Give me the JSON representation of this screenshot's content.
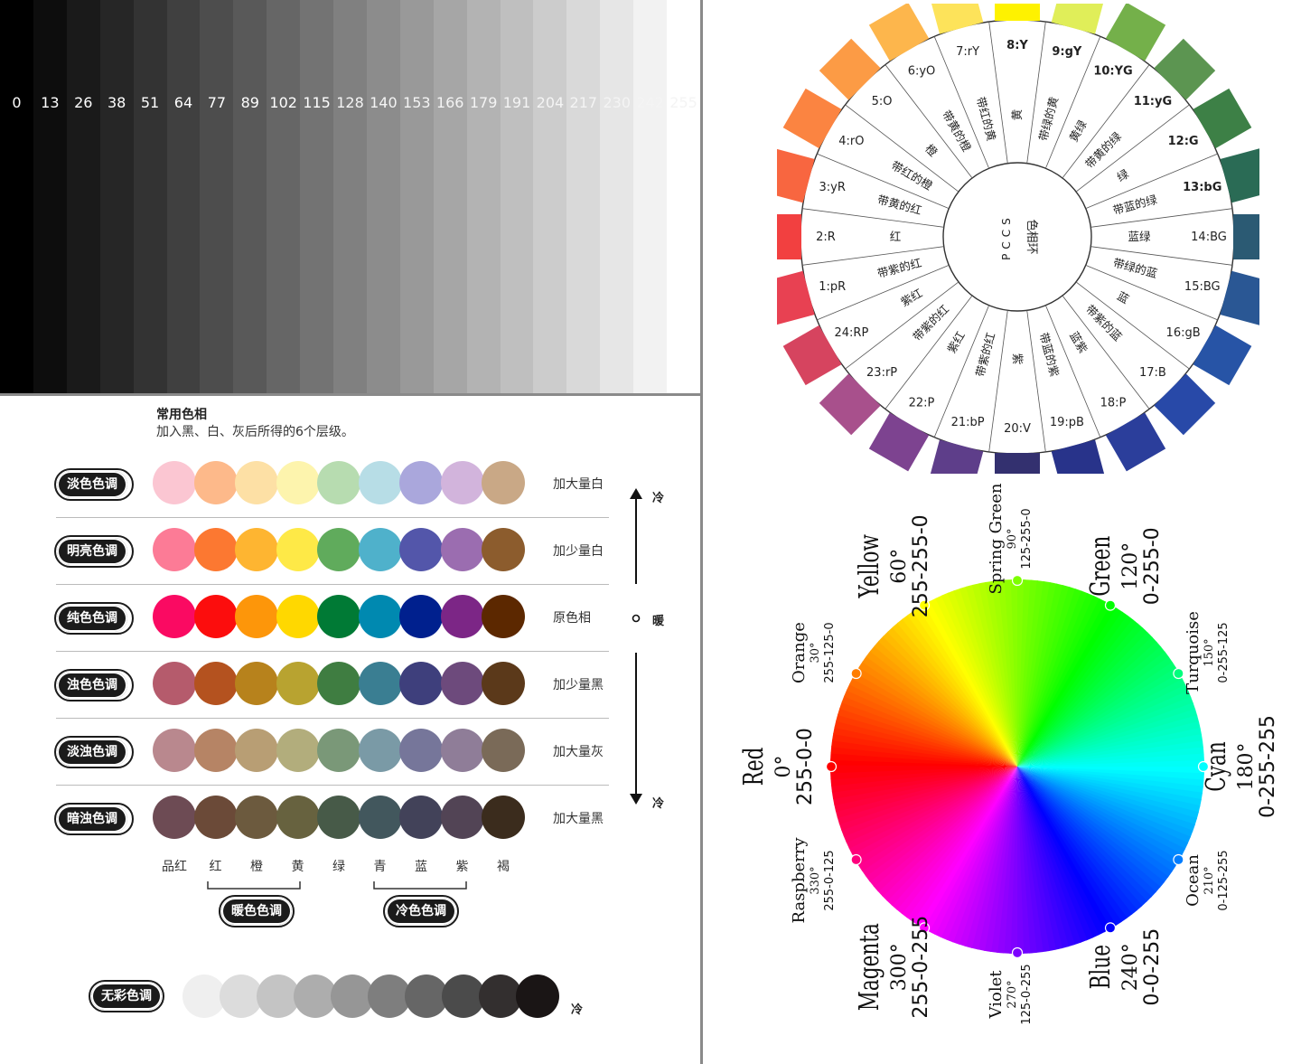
{
  "grayscale": {
    "values": [
      "0",
      "13",
      "26",
      "38",
      "51",
      "64",
      "77",
      "89",
      "102",
      "115",
      "128",
      "140",
      "153",
      "166",
      "179",
      "191",
      "204",
      "217",
      "230",
      "242",
      "255"
    ]
  },
  "hue_chart": {
    "title": "常用色相",
    "subtitle": "加入黑、白、灰后所得的6个层级。",
    "rows": [
      {
        "label": "淡色色调",
        "note": "加大量白",
        "colors": [
          "#fbc6d2",
          "#fdb98a",
          "#fde0a5",
          "#fdf4ad",
          "#b7dcb0",
          "#b7dde6",
          "#aaa7dc",
          "#d2b4dc",
          "#c9a886"
        ]
      },
      {
        "label": "明亮色调",
        "note": "加少量白",
        "colors": [
          "#fc7b96",
          "#fc7831",
          "#feb531",
          "#fee947",
          "#60ab5c",
          "#4fb1cb",
          "#5356aa",
          "#9b6db0",
          "#8c5c2d"
        ]
      },
      {
        "label": "纯色色调",
        "note": "原色相",
        "colors": [
          "#fa0a62",
          "#fc0d0d",
          "#fd960a",
          "#ffd800",
          "#007a35",
          "#0089b0",
          "#00208e",
          "#7c2686",
          "#5c2800"
        ]
      },
      {
        "label": "浊色色调",
        "note": "加少量黑",
        "colors": [
          "#b55b6c",
          "#b4521f",
          "#b7821c",
          "#b8a330",
          "#3f7d41",
          "#3a7e92",
          "#3e3f7c",
          "#6d4a7c",
          "#5b391a"
        ]
      },
      {
        "label": "淡浊色调",
        "note": "加大量灰",
        "colors": [
          "#b9888e",
          "#b68465",
          "#b89e74",
          "#b2ad7c",
          "#7a9878",
          "#7a9aa6",
          "#76769a",
          "#8f7d98",
          "#7a6a58"
        ]
      },
      {
        "label": "暗浊色调",
        "note": "加大量黑",
        "colors": [
          "#6d4b54",
          "#6b4a38",
          "#6c5a3e",
          "#67623f",
          "#475a48",
          "#42575d",
          "#424259",
          "#524455",
          "#3b2c1d"
        ]
      }
    ],
    "hue_names": [
      "品红",
      "红",
      "橙",
      "黄",
      "绿",
      "青",
      "蓝",
      "紫",
      "褐"
    ],
    "warm_label": "暖色色调",
    "cool_label": "冷色色调",
    "side_cold_top": "冷",
    "side_warm": "暖",
    "side_cold_bottom": "冷",
    "achromatic": {
      "label": "无彩色调",
      "note": "冷",
      "colors": [
        "#efefef",
        "#dcdcdc",
        "#c4c4c4",
        "#adadad",
        "#969696",
        "#7e7e7e",
        "#666666",
        "#4b4b4b",
        "#332f2f",
        "#1a1515"
      ]
    }
  },
  "pccs": {
    "center_line1": "PCCS",
    "center_line2": "色相环",
    "hues": [
      {
        "code": "1:pR",
        "color": "#e84152",
        "cn": "带紫的红"
      },
      {
        "code": "2:R",
        "color": "#f24040",
        "cn": "红"
      },
      {
        "code": "3:yR",
        "color": "#f86640",
        "cn": "带黄的红"
      },
      {
        "code": "4:rO",
        "color": "#fb8441",
        "cn": "带红的橙"
      },
      {
        "code": "5:O",
        "color": "#fc9b45",
        "cn": "橙"
      },
      {
        "code": "6:yO",
        "color": "#fdb64c",
        "cn": "带黄的橙"
      },
      {
        "code": "7:rY",
        "color": "#fde35a",
        "cn": "带红的黄"
      },
      {
        "code": "8:Y",
        "color": "#fef200",
        "cn": "黄"
      },
      {
        "code": "9:gY",
        "color": "#e0ee59",
        "cn": "带绿的黄"
      },
      {
        "code": "10:YG",
        "color": "#74b04a",
        "cn": "黄绿"
      },
      {
        "code": "11:yG",
        "color": "#5c9551",
        "cn": "带黄的绿"
      },
      {
        "code": "12:G",
        "color": "#3d8046",
        "cn": "绿"
      },
      {
        "code": "13:bG",
        "color": "#2a6b55",
        "cn": "带蓝的绿"
      },
      {
        "code": "14:BG",
        "color": "#2b5a73",
        "cn": "蓝绿"
      },
      {
        "code": "15:BG",
        "color": "#2a5794",
        "cn": "带绿的蓝"
      },
      {
        "code": "16:gB",
        "color": "#2754a6",
        "cn": "蓝"
      },
      {
        "code": "17:B",
        "color": "#2849a8",
        "cn": "带紫的蓝"
      },
      {
        "code": "18:P",
        "color": "#2b3e9b",
        "cn": "蓝紫"
      },
      {
        "code": "19:pB",
        "color": "#28338a",
        "cn": "带蓝的紫"
      },
      {
        "code": "20:V",
        "color": "#33306f",
        "cn": "紫"
      },
      {
        "code": "21:bP",
        "color": "#5e3e8a",
        "cn": "带紫的红"
      },
      {
        "code": "22:P",
        "color": "#7d4390",
        "cn": "紫红"
      },
      {
        "code": "23:rP",
        "color": "#a8508c",
        "cn": "带紫的红"
      },
      {
        "code": "24:RP",
        "color": "#d6445f",
        "cn": "紫红"
      }
    ]
  },
  "rgb_wheel": {
    "colors": [
      {
        "name": "Red",
        "deg": "0°",
        "rgb": "255-0-0",
        "hex": "#ff0000",
        "big": true
      },
      {
        "name": "Orange",
        "deg": "30°",
        "rgb": "255-125-0",
        "hex": "#ff7d00",
        "big": false
      },
      {
        "name": "Yellow",
        "deg": "60°",
        "rgb": "255-255-0",
        "hex": "#ffff00",
        "big": true
      },
      {
        "name": "Spring Green",
        "deg": "90°",
        "rgb": "125-255-0",
        "hex": "#7dff00",
        "big": false
      },
      {
        "name": "Green",
        "deg": "120°",
        "rgb": "0-255-0",
        "hex": "#00ff00",
        "big": true
      },
      {
        "name": "Turquoise",
        "deg": "150°",
        "rgb": "0-255-125",
        "hex": "#00ff7d",
        "big": false
      },
      {
        "name": "Cyan",
        "deg": "180°",
        "rgb": "0-255-255",
        "hex": "#00ffff",
        "big": true
      },
      {
        "name": "Ocean",
        "deg": "210°",
        "rgb": "0-125-255",
        "hex": "#007dff",
        "big": false
      },
      {
        "name": "Blue",
        "deg": "240°",
        "rgb": "0-0-255",
        "hex": "#0000ff",
        "big": true
      },
      {
        "name": "Violet",
        "deg": "270°",
        "rgb": "125-0-255",
        "hex": "#7d00ff",
        "big": false
      },
      {
        "name": "Magenta",
        "deg": "300°",
        "rgb": "255-0-255",
        "hex": "#ff00ff",
        "big": true
      },
      {
        "name": "Raspberry",
        "deg": "330°",
        "rgb": "255-0-125",
        "hex": "#ff007d",
        "big": false
      }
    ]
  }
}
